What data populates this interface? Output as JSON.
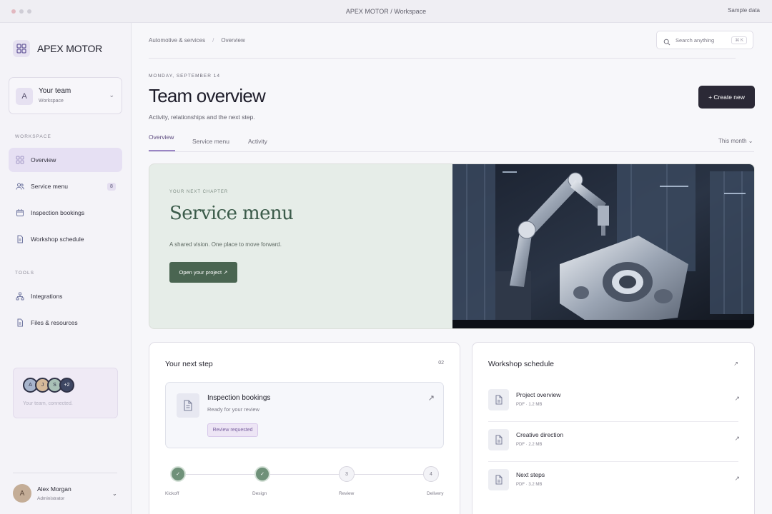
{
  "window": {
    "title": "APEX MOTOR / Workspace",
    "right_label": "Sample data"
  },
  "brand": {
    "name": "APEX MOTOR"
  },
  "team_switcher": {
    "initial": "A",
    "name": "Your team",
    "sub": "Workspace"
  },
  "sidebar": {
    "workspace_label": "WORKSPACE",
    "tools_label": "TOOLS",
    "workspace_items": [
      {
        "label": "Overview",
        "icon": "grid-icon",
        "active": true
      },
      {
        "label": "Service menu",
        "icon": "users-icon",
        "badge": "8"
      },
      {
        "label": "Inspection bookings",
        "icon": "calendar-icon"
      },
      {
        "label": "Workshop schedule",
        "icon": "document-icon"
      }
    ],
    "tool_items": [
      {
        "label": "Integrations",
        "icon": "nodes-icon"
      },
      {
        "label": "Files & resources",
        "icon": "document-icon"
      }
    ],
    "team_card": {
      "avatars": [
        "A",
        "J",
        "S",
        "+2"
      ],
      "text": "Your team, connected."
    },
    "user": {
      "initial": "A",
      "name": "Alex Morgan",
      "role": "Administrator"
    }
  },
  "header": {
    "breadcrumbs": [
      "Automotive & services",
      "Overview"
    ],
    "search": {
      "placeholder": "Search anything",
      "shortcut": "⌘ K"
    },
    "date": "MONDAY, SEPTEMBER 14",
    "title": "Team overview",
    "subtitle": "Activity, relationships and the next step.",
    "create_label": "+ Create new",
    "tabs": [
      "Overview",
      "Service menu",
      "Activity"
    ],
    "period": "This month ⌄"
  },
  "hero": {
    "kicker": "YOUR NEXT CHAPTER",
    "title": "Service menu",
    "text": "A shared vision. One place to move forward.",
    "button": "Open your project ↗"
  },
  "next_step": {
    "title": "Your next step",
    "count": "02",
    "task": {
      "title": "Inspection bookings",
      "sub": "Ready for your review",
      "badge": "Review requested"
    },
    "steps": [
      {
        "label": "Kickoff",
        "mark": "✓",
        "done": true
      },
      {
        "label": "Design",
        "mark": "✓",
        "done": true
      },
      {
        "label": "Review",
        "mark": "3",
        "done": false
      },
      {
        "label": "Delivery",
        "mark": "4",
        "done": false
      }
    ]
  },
  "schedule": {
    "title": "Workshop schedule",
    "files": [
      {
        "name": "Project overview",
        "meta": "PDF · 1.2 MB"
      },
      {
        "name": "Creative direction",
        "meta": "PDF · 2.2 MB"
      },
      {
        "name": "Next steps",
        "meta": "PDF · 3.2 MB"
      }
    ]
  },
  "colors": {
    "accent": "#9a85c4",
    "hero_green": "#4a6551",
    "dark_button": "#2b2936"
  }
}
